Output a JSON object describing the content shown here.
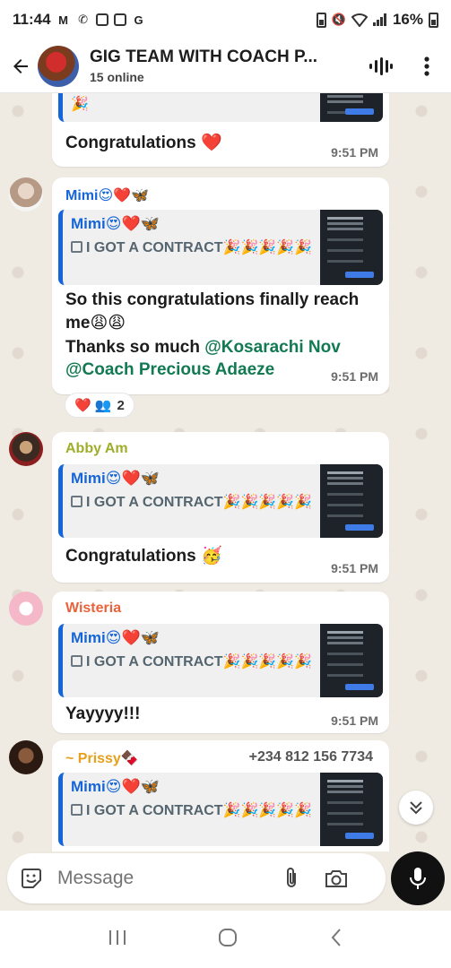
{
  "status_bar": {
    "time": "11:44",
    "battery": "16%"
  },
  "header": {
    "title": "GIG TEAM WITH COACH P...",
    "subtitle": "15 online"
  },
  "messages": [
    {
      "text": "Congratulations ❤️",
      "time": "9:51 PM",
      "top_quote_line": "🎉"
    },
    {
      "sender": "Mimi😍❤️🦋",
      "quote_name": "Mimi😍❤️🦋",
      "quote_text": "I GOT A CONTRACT🎉🎉🎉🎉🎉",
      "text_line1": "So this congratulations finally reach",
      "text_line2": "me😩😩",
      "text_line3": "Thanks so much ",
      "mention1": "@Kosarachi Nov",
      "mention2": "@Coach Precious Adaeze",
      "time": "9:51 PM",
      "reactions": {
        "emojis": "❤️ 👥",
        "count": "2"
      }
    },
    {
      "sender": "Abby Am",
      "quote_name": "Mimi😍❤️🦋",
      "quote_text": "I GOT A CONTRACT🎉🎉🎉🎉🎉",
      "text": "Congratulations 🥳",
      "time": "9:51 PM"
    },
    {
      "sender": "Wisteria",
      "quote_name": "Mimi😍❤️🦋",
      "quote_text": "I GOT A CONTRACT🎉🎉🎉🎉🎉",
      "text": "Yayyyy!!!",
      "time": "9:51 PM"
    },
    {
      "sender": "~ Prissy🍫",
      "phone": "+234 812 156 7734",
      "quote_name": "Mimi😍❤️🦋",
      "quote_text": "I GOT A CONTRACT🎉🎉🎉🎉🎉"
    }
  ],
  "input": {
    "placeholder": "Message"
  },
  "colors": {
    "mimi": "#1565d8",
    "abby": "#9fae2a",
    "wisteria": "#e8623a",
    "prissy": "#e6a019",
    "mention": "#127a52",
    "chat_bg": "#efeae2"
  },
  "icons": [
    "back-arrow-icon",
    "voice-chat-icon",
    "more-vert-icon",
    "doc-icon",
    "sticker-icon",
    "attach-icon",
    "camera-icon",
    "mic-icon",
    "chevron-double-down-icon"
  ]
}
